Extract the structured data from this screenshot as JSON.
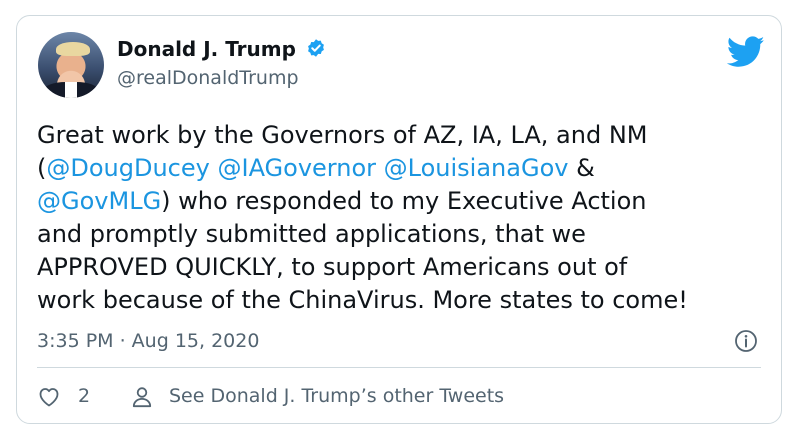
{
  "tweet": {
    "author_name": "Donald J. Trump",
    "author_handle": "@realDonaldTrump",
    "verified": true,
    "lines": [
      [
        {
          "text": "Great work by the Governors of AZ, IA, LA, and NM",
          "mention": false
        }
      ],
      [
        {
          "text": "(",
          "mention": false
        },
        {
          "text": "@DougDucey",
          "mention": true
        },
        {
          "text": " ",
          "mention": false
        },
        {
          "text": "@IAGovernor",
          "mention": true
        },
        {
          "text": " ",
          "mention": false
        },
        {
          "text": "@LouisianaGov",
          "mention": true
        },
        {
          "text": " &",
          "mention": false
        }
      ],
      [
        {
          "text": "@GovMLG",
          "mention": true
        },
        {
          "text": ") who responded to my Executive Action",
          "mention": false
        }
      ],
      [
        {
          "text": "and promptly submitted applications, that we",
          "mention": false
        }
      ],
      [
        {
          "text": "APPROVED QUICKLY, to support Americans out of",
          "mention": false
        }
      ],
      [
        {
          "text": "work because of the ChinaVirus. More states to come!",
          "mention": false
        }
      ]
    ],
    "timestamp": "3:35 PM · Aug 15, 2020",
    "like_count": "2",
    "see_other_tweets_label": "See Donald J. Trump’s other Tweets"
  },
  "icons": {
    "verified": "verified-badge-icon",
    "brand": "twitter-bird-icon",
    "info": "info-icon",
    "like": "heart-icon",
    "profile": "person-icon"
  },
  "colors": {
    "text": "#0f1419",
    "secondary": "#536471",
    "mention": "#1b95e0",
    "brand": "#1da1f2",
    "border": "#cfd9de"
  }
}
